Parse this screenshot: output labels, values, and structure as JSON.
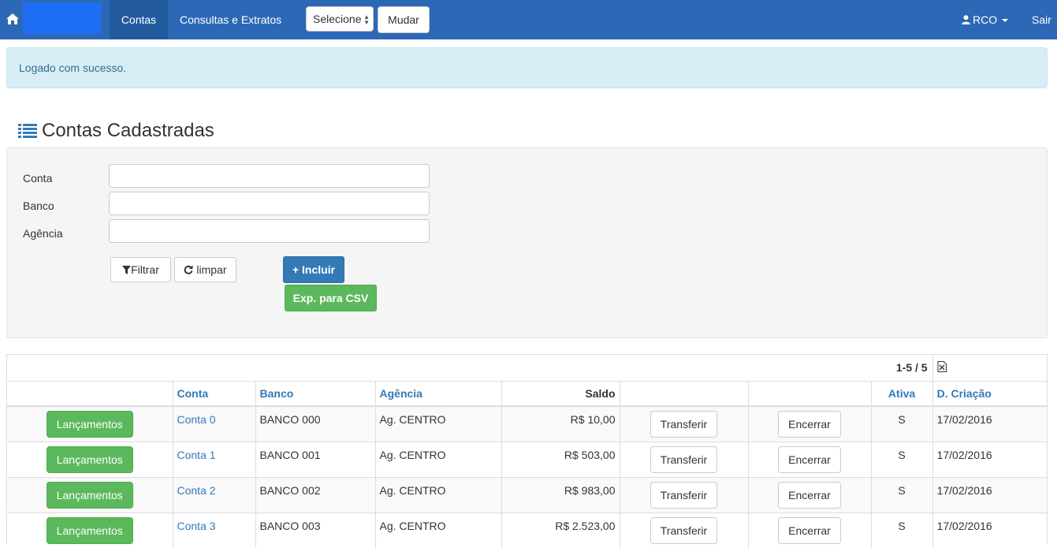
{
  "navbar": {
    "home_icon": "home-icon",
    "brand_color": "#1e6ef5",
    "links": [
      {
        "label": "Contas",
        "active": true
      },
      {
        "label": "Consultas e Extratos",
        "active": false
      }
    ],
    "select_value": "Selecione",
    "change_button": "Mudar",
    "user_label": "RCO",
    "logout_label": "Sair"
  },
  "alert": {
    "message": "Logado com sucesso."
  },
  "page": {
    "title": "Contas Cadastradas",
    "title_icon": "list-icon"
  },
  "filter": {
    "fields": [
      {
        "label": "Conta",
        "value": ""
      },
      {
        "label": "Banco",
        "value": ""
      },
      {
        "label": "Agência",
        "value": ""
      }
    ],
    "filter_button": "Filtrar",
    "clear_button": "limpar",
    "add_button": "Incluir",
    "export_button": "Exp. para CSV"
  },
  "table": {
    "pagination": "1-5 / 5",
    "export_icon": "excel-file-icon",
    "headers": {
      "conta": "Conta",
      "banco": "Banco",
      "agencia": "Agência",
      "saldo": "Saldo",
      "ativa": "Ativa",
      "criacao": "D. Criação"
    },
    "rows": [
      {
        "action": "Lançamentos",
        "conta": "Conta 0",
        "banco": "BANCO 000",
        "agencia": "Ag. CENTRO",
        "saldo": "R$ 10,00",
        "transfer": "Transferir",
        "close": "Encerrar",
        "ativa": "S",
        "criacao": "17/02/2016"
      },
      {
        "action": "Lançamentos",
        "conta": "Conta 1",
        "banco": "BANCO 001",
        "agencia": "Ag. CENTRO",
        "saldo": "R$ 503,00",
        "transfer": "Transferir",
        "close": "Encerrar",
        "ativa": "S",
        "criacao": "17/02/2016"
      },
      {
        "action": "Lançamentos",
        "conta": "Conta 2",
        "banco": "BANCO 002",
        "agencia": "Ag. CENTRO",
        "saldo": "R$ 983,00",
        "transfer": "Transferir",
        "close": "Encerrar",
        "ativa": "S",
        "criacao": "17/02/2016"
      },
      {
        "action": "Lançamentos",
        "conta": "Conta 3",
        "banco": "BANCO 003",
        "agencia": "Ag. CENTRO",
        "saldo": "R$ 2.523,00",
        "transfer": "Transferir",
        "close": "Encerrar",
        "ativa": "S",
        "criacao": "17/02/2016"
      }
    ]
  }
}
